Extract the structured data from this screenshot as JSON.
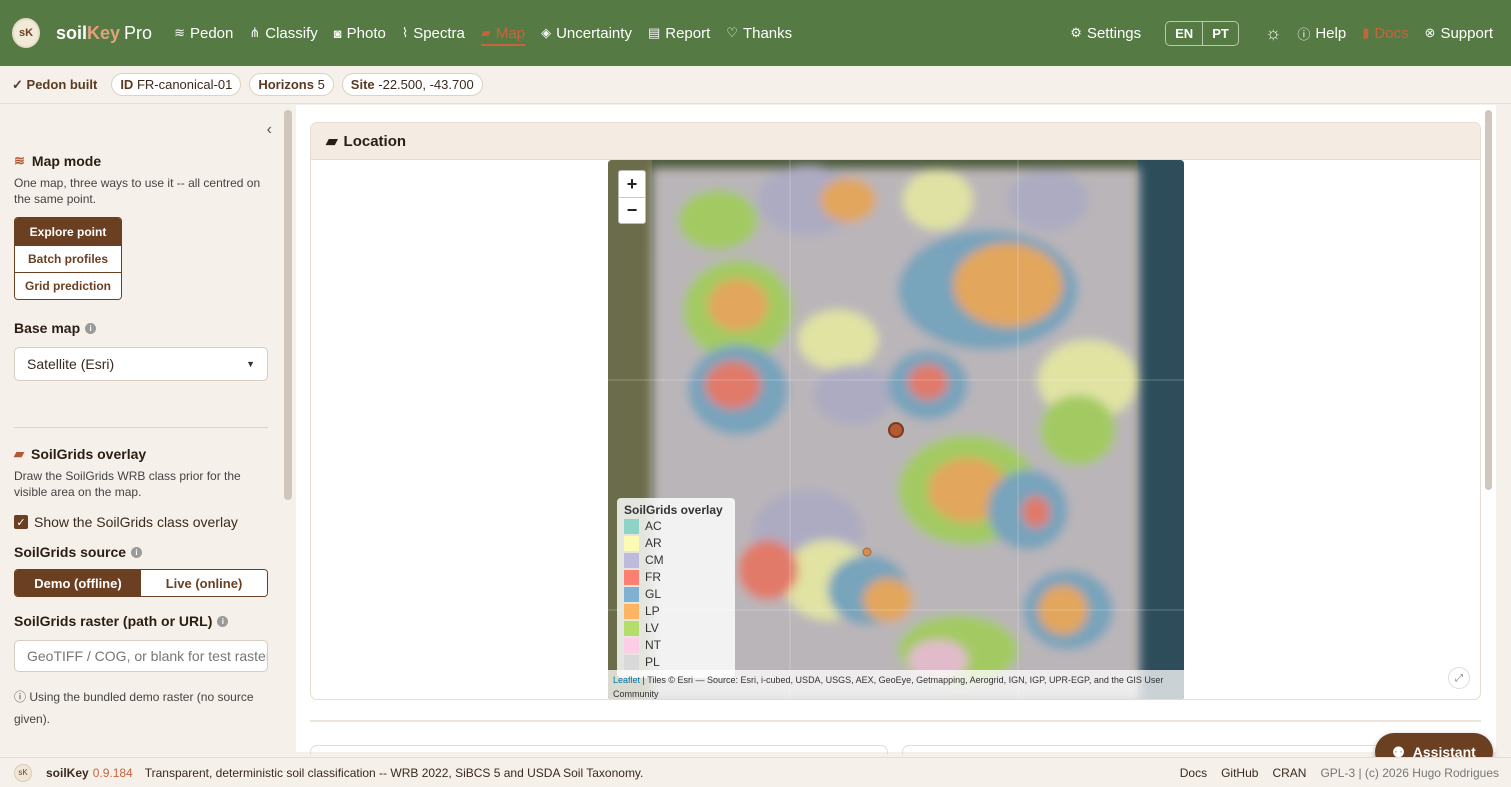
{
  "navbar": {
    "brand_logo_text": "sK",
    "brand_soil": "soil",
    "brand_key": "Key",
    "brand_pro": "Pro",
    "items": [
      {
        "label": "Pedon",
        "icon": "layers-icon"
      },
      {
        "label": "Classify",
        "icon": "sitemap-icon"
      },
      {
        "label": "Photo",
        "icon": "camera-icon"
      },
      {
        "label": "Spectra",
        "icon": "wave-icon"
      },
      {
        "label": "Map",
        "icon": "map-icon"
      },
      {
        "label": "Uncertainty",
        "icon": "dice-icon"
      },
      {
        "label": "Report",
        "icon": "file-icon"
      },
      {
        "label": "Thanks",
        "icon": "heart-icon"
      }
    ],
    "active_item": "Map",
    "settings": "Settings",
    "lang_en": "EN",
    "lang_pt": "PT",
    "help": "Help",
    "docs": "Docs",
    "support": "Support",
    "accent_color": "#c8643a",
    "bg_color": "#557a44"
  },
  "status": {
    "built": "Pedon built",
    "id_label": "ID",
    "id_value": "FR-canonical-01",
    "horizons_label": "Horizons",
    "horizons_value": "5",
    "site_label": "Site",
    "site_value": "-22.500, -43.700"
  },
  "sidebar": {
    "map_mode_title": "Map mode",
    "map_mode_help": "One map, three ways to use it -- all centred on the same point.",
    "modes": [
      "Explore point",
      "Batch profiles",
      "Grid prediction"
    ],
    "active_mode": "Explore point",
    "base_map_label": "Base map",
    "base_map_value": "Satellite (Esri)",
    "soilgrids_title": "SoilGrids overlay",
    "soilgrids_help": "Draw the SoilGrids WRB class prior for the visible area on the map.",
    "overlay_checkbox": "Show the SoilGrids class overlay",
    "overlay_checked": true,
    "source_label": "SoilGrids source",
    "source_options": [
      "Demo (offline)",
      "Live (online)"
    ],
    "active_source": "Demo (offline)",
    "raster_label": "SoilGrids raster (path or URL)",
    "raster_placeholder": "GeoTIFF / COG, or blank for test raster",
    "note": "Using the bundled demo raster (no source given)."
  },
  "main": {
    "card_title": "Location",
    "zoom_in": "+",
    "zoom_out": "−",
    "legend_title": "SoilGrids overlay",
    "legend": [
      {
        "code": "AC",
        "color": "#8fd3c7"
      },
      {
        "code": "AR",
        "color": "#fbfbb6"
      },
      {
        "code": "CM",
        "color": "#bebada"
      },
      {
        "code": "FR",
        "color": "#fb8072"
      },
      {
        "code": "GL",
        "color": "#80b1d3"
      },
      {
        "code": "LP",
        "color": "#fdb462"
      },
      {
        "code": "LV",
        "color": "#b3de69"
      },
      {
        "code": "NT",
        "color": "#fccde5"
      },
      {
        "code": "PL",
        "color": "#d9d9d9"
      }
    ],
    "attrib_leaflet": "Leaflet",
    "attrib_text": "| Tiles © Esri — Source: Esri, i-cubed, USDA, USGS, AEX, GeoEye, Getmapping, Aerogrid, IGN, IGP, UPR-EGP, and the GIS User Community"
  },
  "assistant": "Assistant",
  "footer": {
    "name": "soilKey",
    "version": "0.9.184",
    "tagline": "Transparent, deterministic soil classification -- WRB 2022, SiBCS 5 and USDA Soil Taxonomy.",
    "links": [
      "Docs",
      "GitHub",
      "CRAN"
    ],
    "license": "GPL-3 | (c) 2026 Hugo Rodrigues"
  }
}
